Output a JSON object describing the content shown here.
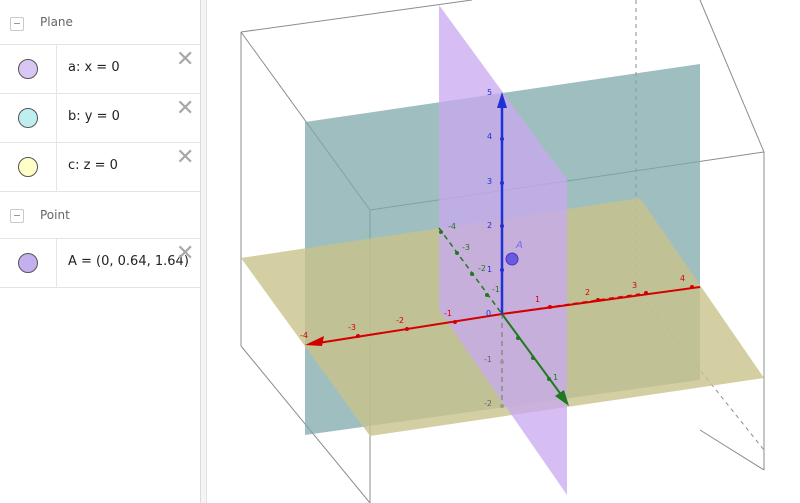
{
  "algebra": {
    "groups": [
      {
        "title": "Plane",
        "items": [
          {
            "definition": "a: x = 0",
            "color": "#d8c6f3"
          },
          {
            "definition": "b: y = 0",
            "color": "#bfeeee"
          },
          {
            "definition": "c: z = 0",
            "color": "#ffffc8"
          }
        ]
      },
      {
        "title": "Point",
        "items": [
          {
            "definition": "A = (0, 0.64, 1.64)",
            "color": "#c4b0ee"
          }
        ]
      }
    ]
  },
  "graphics3d": {
    "point_label": "A",
    "x_axis_ticks": [
      "-4",
      "-3",
      "-2",
      "-1",
      "1",
      "2",
      "3",
      "4"
    ],
    "y_axis_ticks": [
      "-4",
      "-3",
      "-2",
      "-1",
      "1"
    ],
    "z_axis_ticks": [
      "-2",
      "-1",
      "1",
      "2",
      "3",
      "4",
      "5"
    ],
    "origin_label": "0",
    "colors": {
      "x_axis": "#d40000",
      "y_axis": "#1f7a1f",
      "z_axis": "#1f30d6",
      "plane_xz": "#7fa8aa",
      "plane_yz": "#c8a8f0",
      "plane_xy": "#c8c38c",
      "point": "#6a5ae0"
    }
  }
}
